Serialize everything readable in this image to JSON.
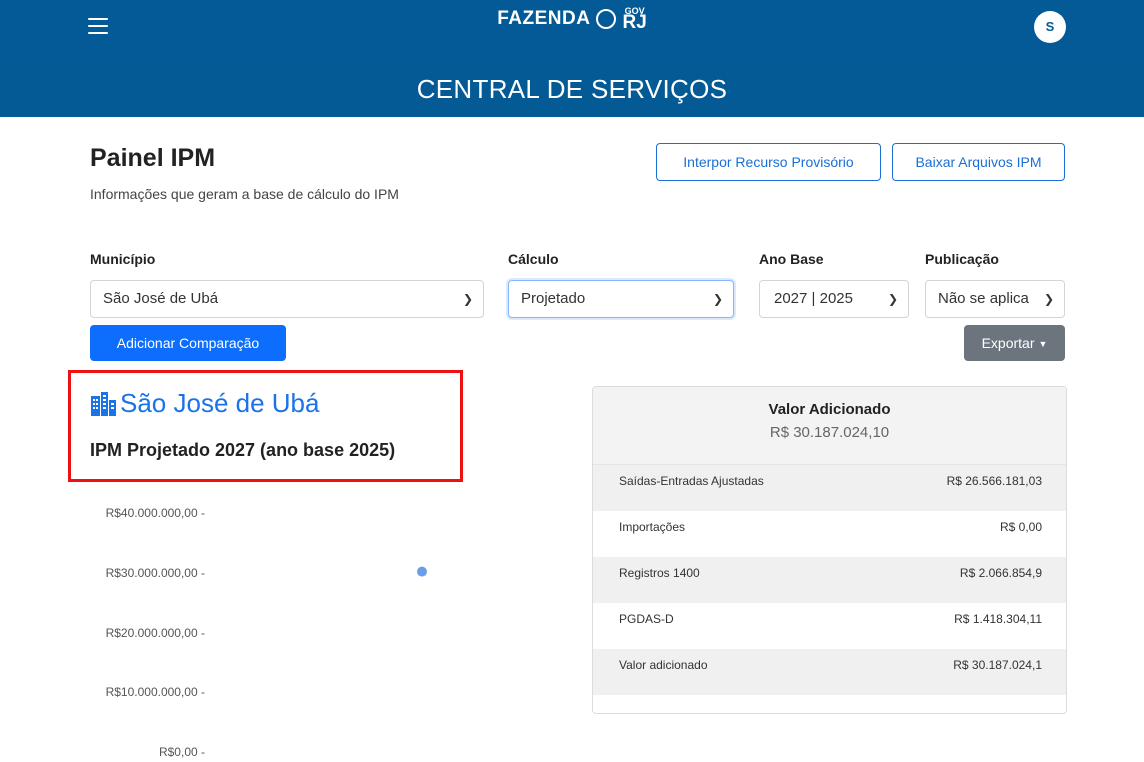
{
  "header": {
    "brand": "FAZENDA",
    "gov_small": "GOV",
    "gov_large": "RJ",
    "avatar_initial": "S",
    "section_title": "CENTRAL DE SERVIÇOS"
  },
  "page": {
    "title": "Painel IPM",
    "description": "Informações que geram a base de cálculo do IPM",
    "buttons": {
      "interpor": "Interpor Recurso Provisório",
      "baixar": "Baixar Arquivos IPM",
      "adicionar": "Adicionar Comparação",
      "exportar": "Exportar"
    }
  },
  "filters": {
    "municipio": {
      "label": "Município",
      "value": "São José de Ubá"
    },
    "calculo": {
      "label": "Cálculo",
      "value": "Projetado"
    },
    "ano_base": {
      "label": "Ano Base",
      "value": "2027 | 2025"
    },
    "publicacao": {
      "label": "Publicação",
      "value": "Não se aplica"
    }
  },
  "summary": {
    "municipality": "São José de Ubá",
    "subtitle": "IPM Projetado 2027 (ano base 2025)"
  },
  "chart_data": {
    "type": "scatter",
    "y_ticks": [
      "R$40.000.000,00 -",
      "R$30.000.000,00 -",
      "R$20.000.000,00 -",
      "R$10.000.000,00 -",
      "R$0,00 -"
    ],
    "ylim": [
      0,
      40000000
    ],
    "points": [
      {
        "y": 30187024.1
      }
    ],
    "point_color": "#6b9de8"
  },
  "card": {
    "title": "Valor Adicionado",
    "total": "R$ 30.187.024,10",
    "rows": [
      {
        "label": "Saídas-Entradas Ajustadas",
        "value": "R$ 26.566.181,03"
      },
      {
        "label": "Importações",
        "value": "R$ 0,00"
      },
      {
        "label": "Registros 1400",
        "value": "R$ 2.066.854,9"
      },
      {
        "label": "PGDAS-D",
        "value": "R$ 1.418.304,11"
      },
      {
        "label": "Valor adicionado",
        "value": "R$ 30.187.024,1"
      }
    ]
  },
  "colors": {
    "header_bg": "#035a96",
    "primary": "#0d6efd",
    "link_blue": "#1a73e8",
    "highlight_red": "#e11111",
    "secondary": "#6c757d"
  }
}
